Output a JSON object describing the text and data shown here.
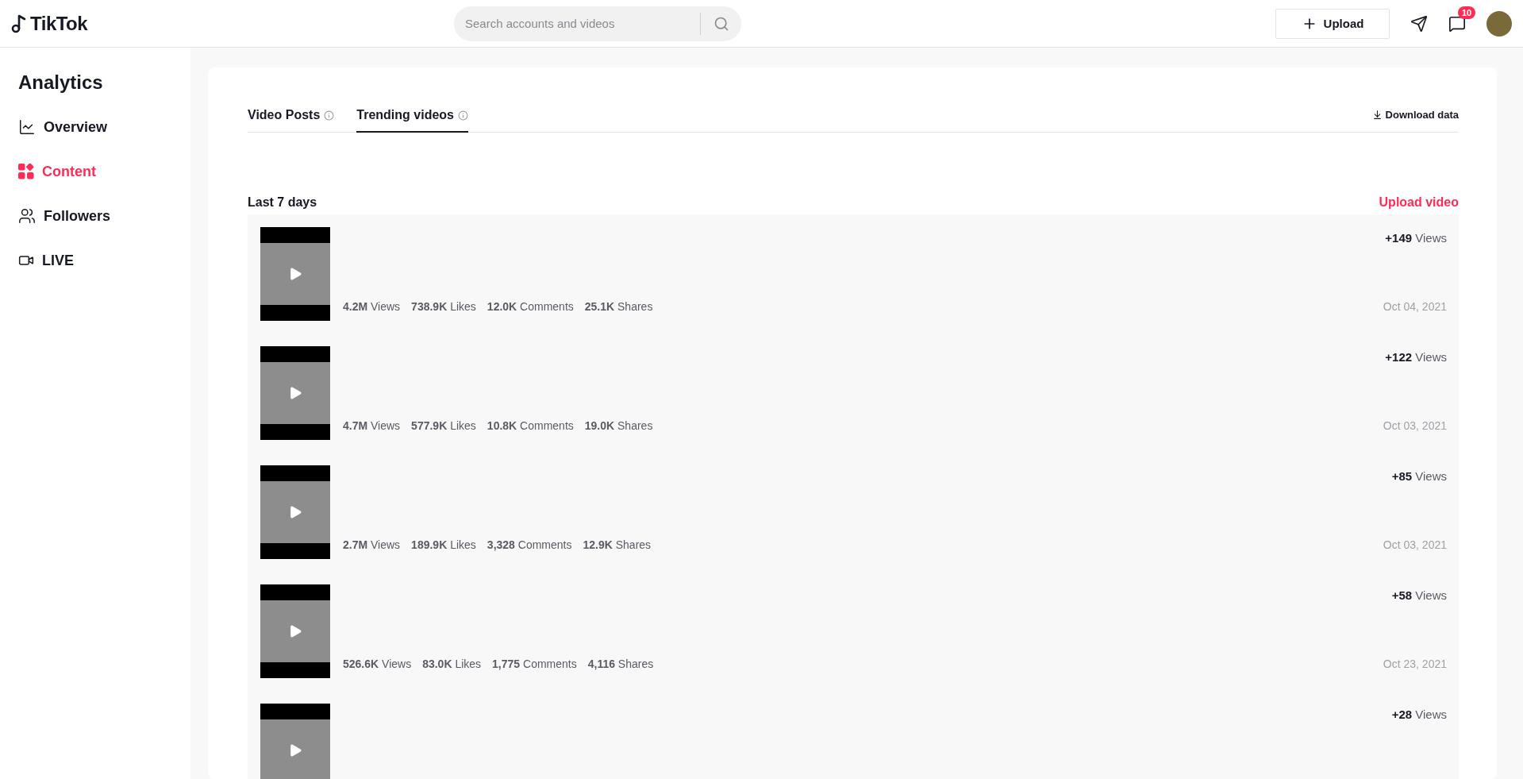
{
  "header": {
    "logo": "TikTok",
    "search": {
      "placeholder": "Search accounts and videos"
    },
    "upload_button": "Upload",
    "inbox_badge": "10"
  },
  "sidebar": {
    "title": "Analytics",
    "items": [
      {
        "label": "Overview",
        "kind": "chart",
        "selected": false
      },
      {
        "label": "Content",
        "kind": "content",
        "selected": true
      },
      {
        "label": "Followers",
        "kind": "followers",
        "selected": false
      },
      {
        "label": "LIVE",
        "kind": "live",
        "selected": false
      }
    ]
  },
  "tabs": [
    {
      "label": "Video Posts",
      "selected": false
    },
    {
      "label": "Trending videos",
      "selected": true
    }
  ],
  "download_link": "Download data",
  "section": {
    "title": "Last 7 days",
    "upload_link": "Upload video"
  },
  "videos": [
    {
      "trend_value": "+149",
      "trend_label": "Views",
      "date": "Oct 04, 2021",
      "stats": [
        "**4.2M** Views",
        "**738.9K** Likes",
        "**12.0K** Comments",
        "**25.1K** Shares"
      ]
    },
    {
      "trend_value": "+122",
      "trend_label": "Views",
      "date": "Oct 03, 2021",
      "stats": [
        "**4.7M** Views",
        "**577.9K** Likes",
        "**10.8K** Comments",
        "**19.0K** Shares"
      ]
    },
    {
      "trend_value": "+85",
      "trend_label": "Views",
      "date": "Oct 03, 2021",
      "stats": [
        "**2.7M** Views",
        "**189.9K** Likes",
        "**3,328** Comments",
        "**12.9K** Shares"
      ]
    },
    {
      "trend_value": "+58",
      "trend_label": "Views",
      "date": "Oct 23, 2021",
      "stats": [
        "**526.6K** Views",
        "**83.0K** Likes",
        "**1,775** Comments",
        "**4,116** Shares"
      ]
    },
    {
      "trend_value": "+28",
      "trend_label": "Views"
    }
  ]
}
